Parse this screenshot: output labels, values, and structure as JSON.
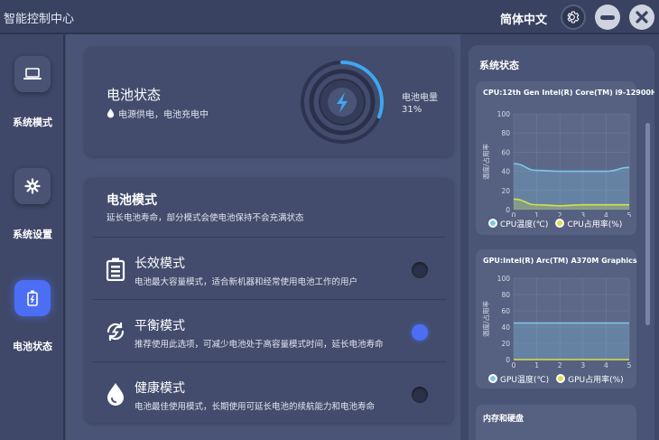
{
  "app": {
    "title": "智能控制中心",
    "language": "简体中文"
  },
  "sidebar": {
    "items": [
      {
        "label": "系统模式",
        "icon": "laptop-icon"
      },
      {
        "label": "系统设置",
        "icon": "gear-icon"
      },
      {
        "label": "电池状态",
        "icon": "battery-icon",
        "active": true
      }
    ]
  },
  "battery": {
    "title": "电池状态",
    "subtitle": "电源供电，电池充电中",
    "level_label": "电池电量",
    "level": "31%",
    "level_fraction": 0.31
  },
  "modes": {
    "title": "电池模式",
    "subtitle": "延长电池寿命，部分模式会使电池保持不会充满状态",
    "items": [
      {
        "name": "长效模式",
        "desc": "电池最大容量模式，适合新机器和经常使用电池工作的用户",
        "icon": "battery-full-icon",
        "selected": false
      },
      {
        "name": "平衡模式",
        "desc": "推荐使用此选项，可减少电池处于高容量模式时间，延长电池寿命",
        "icon": "balance-icon",
        "selected": true
      },
      {
        "name": "健康模式",
        "desc": "电池最佳使用模式，长期使用可延长电池的续航能力和电池寿命",
        "icon": "drop-icon",
        "selected": false
      }
    ]
  },
  "system_status": {
    "title": "系统状态",
    "memory_title": "内存和硬盘"
  },
  "chart_data": [
    {
      "type": "line",
      "title": "CPU:12th Gen Intel(R) Core(TM) i9-12900H",
      "ylabel": "温度/占用率",
      "x": [
        0,
        1,
        2,
        3,
        4,
        5
      ],
      "ylim": [
        0,
        100
      ],
      "yticks": [
        "0",
        "20",
        "40",
        "60",
        "80",
        "100"
      ],
      "xticks": [
        "0",
        "1",
        "2",
        "3",
        "4",
        "5"
      ],
      "series": [
        {
          "name": "CPU温度(℃)",
          "values": [
            48,
            41,
            40,
            40,
            40,
            44
          ],
          "color": "#7fc6e6"
        },
        {
          "name": "CPU占用率(%)",
          "values": [
            11,
            5,
            4,
            5,
            5,
            5
          ],
          "color": "#d8e04a"
        }
      ]
    },
    {
      "type": "line",
      "title": "GPU:Intel(R) Arc(TM) A370M Graphics",
      "ylabel": "温度/占用率",
      "x": [
        0,
        1,
        2,
        3,
        4,
        5
      ],
      "ylim": [
        0,
        100
      ],
      "yticks": [
        "0",
        "20",
        "40",
        "60",
        "80",
        "100"
      ],
      "xticks": [
        "0",
        "1",
        "2",
        "3",
        "4",
        "5"
      ],
      "series": [
        {
          "name": "GPU温度(℃)",
          "values": [
            45,
            45,
            45,
            45,
            45,
            45
          ],
          "color": "#7fc6e6"
        },
        {
          "name": "GPU占用率(%)",
          "values": [
            0,
            0,
            0,
            0,
            0,
            0
          ],
          "color": "#d8e04a"
        }
      ]
    }
  ]
}
